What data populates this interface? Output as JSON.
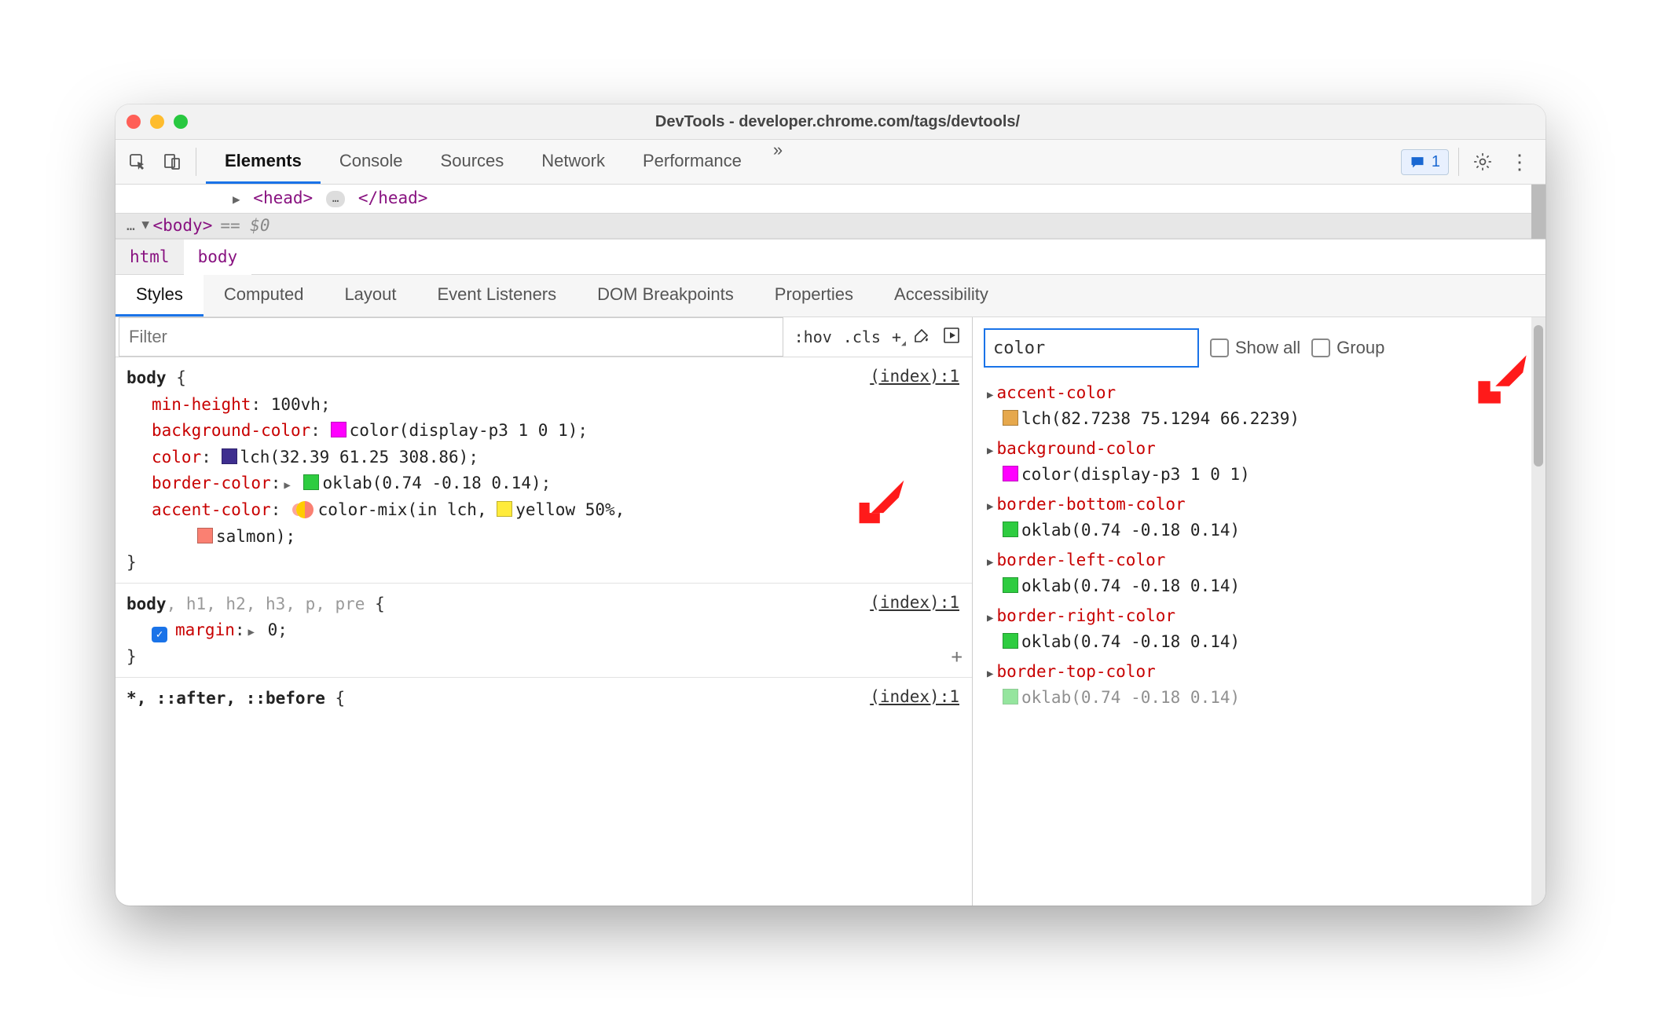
{
  "title": "DevTools - developer.chrome.com/tags/devtools/",
  "topTabs": [
    "Elements",
    "Console",
    "Sources",
    "Network",
    "Performance"
  ],
  "topTabsMore": "»",
  "issues": {
    "count": "1"
  },
  "dom": {
    "head_open": "<head>",
    "head_close": "</head>",
    "expand": "…",
    "body_open": "<body>",
    "body_hint": "== $0",
    "dots": "…"
  },
  "breadcrumbs": [
    "html",
    "body"
  ],
  "subTabs": [
    "Styles",
    "Computed",
    "Layout",
    "Event Listeners",
    "DOM Breakpoints",
    "Properties",
    "Accessibility"
  ],
  "stylesFilter": {
    "placeholder": "Filter",
    "hov": ":hov",
    "cls": ".cls",
    "plus": "+"
  },
  "rules": [
    {
      "selector": "body",
      "source": "(index):1",
      "decls": [
        {
          "prop": "min-height",
          "value": "100vh"
        },
        {
          "prop": "background-color",
          "swatch": "#ff00ff",
          "value": "color(display-p3 1 0 1)"
        },
        {
          "prop": "color",
          "swatch": "#3e2e8f",
          "value": "lch(32.39 61.25 308.86)"
        },
        {
          "prop": "border-color",
          "expand": true,
          "swatch": "#2ecc40",
          "value": "oklab(0.74 -0.18 0.14)"
        },
        {
          "prop": "accent-color",
          "mix": true,
          "value_prefix": "color-mix(in lch, ",
          "swatch2": "#ffeb3b",
          "value_mid": "yellow 50%,",
          "swatch3": "#fa8072",
          "value_suffix": "salmon);",
          "value_indented": true
        }
      ]
    },
    {
      "selector_main": "body",
      "selector_dim": ", h1, h2, h3, p, pre",
      "source": "(index):1",
      "decls": [
        {
          "checked": true,
          "prop": "margin",
          "expand": true,
          "value": "0"
        }
      ],
      "add": true
    },
    {
      "selector_dim_full": "*, ::after, ::before",
      "source": "(index):1",
      "decls_cut": true
    }
  ],
  "computed": {
    "filter": "color",
    "showAll": "Show all",
    "group": "Group",
    "items": [
      {
        "name": "accent-color",
        "swatch": "#e6a84c",
        "value": "lch(82.7238 75.1294 66.2239)"
      },
      {
        "name": "background-color",
        "swatch": "#ff00ff",
        "value": "color(display-p3 1 0 1)"
      },
      {
        "name": "border-bottom-color",
        "swatch": "#2ecc40",
        "value": "oklab(0.74 -0.18 0.14)"
      },
      {
        "name": "border-left-color",
        "swatch": "#2ecc40",
        "value": "oklab(0.74 -0.18 0.14)"
      },
      {
        "name": "border-right-color",
        "swatch": "#2ecc40",
        "value": "oklab(0.74 -0.18 0.14)"
      },
      {
        "name": "border-top-color",
        "swatch": "#2ecc40",
        "value": "oklab(0.74 -0.18 0.14)",
        "cut": true
      }
    ]
  }
}
